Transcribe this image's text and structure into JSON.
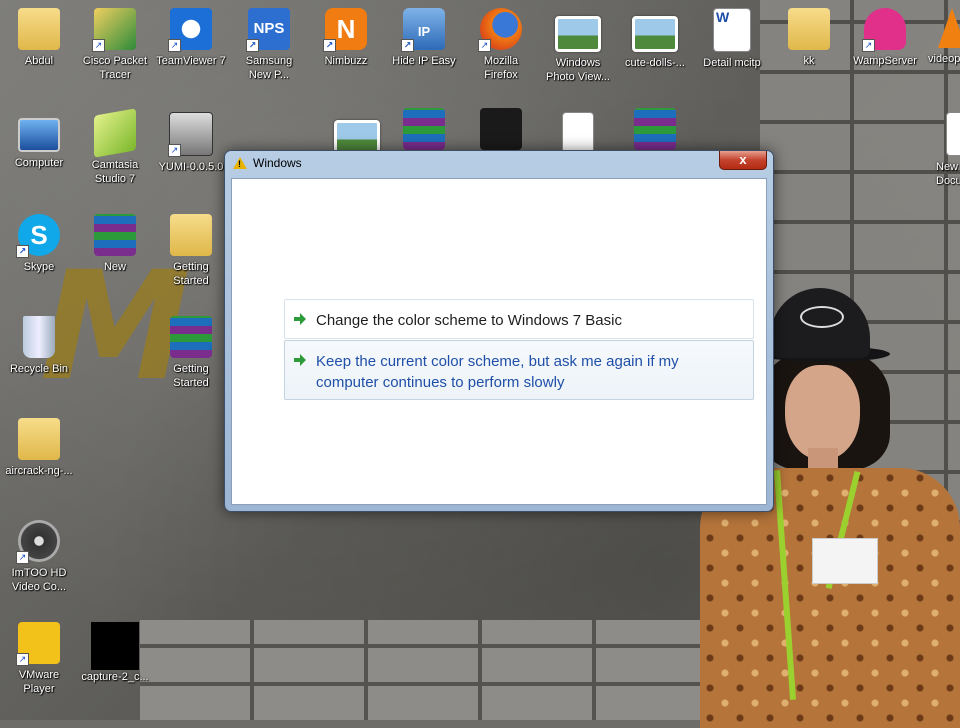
{
  "desktop": {
    "icons": [
      {
        "label": "Abdul",
        "icon": "user-folder-icon"
      },
      {
        "label": "Cisco Packet\nTracer",
        "icon": "cisco-packet-tracer-icon"
      },
      {
        "label": "TeamViewer 7",
        "icon": "teamviewer-icon"
      },
      {
        "label": "Samsung\nNew P...",
        "icon": "samsung-nps-icon",
        "badge": "NPS"
      },
      {
        "label": "Nimbuzz",
        "icon": "nimbuzz-icon",
        "badge": "N"
      },
      {
        "label": "Hide IP Easy",
        "icon": "lock-icon",
        "badge": "IP"
      },
      {
        "label": "Mozilla\nFirefox",
        "icon": "firefox-icon"
      },
      {
        "label": "Windows\nPhoto View...",
        "icon": "photo-viewer-icon"
      },
      {
        "label": "cute-dolls-...",
        "icon": "image-file-icon"
      },
      {
        "label": "Detail mcitp",
        "icon": "word-document-icon",
        "badge": "W"
      },
      {
        "label": "kk",
        "icon": "folder-icon"
      },
      {
        "label": "WampServer",
        "icon": "wampserver-icon"
      },
      {
        "label": "videop",
        "icon": "vlc-icon"
      },
      {
        "label": "Computer",
        "icon": "computer-icon"
      },
      {
        "label": "Camtasia\nStudio 7",
        "icon": "camtasia-icon"
      },
      {
        "label": "YUMI-0.0.5.0",
        "icon": "yumi-icon"
      },
      {
        "label": "New\nDocu",
        "icon": "text-document-icon"
      },
      {
        "label": "Skype",
        "icon": "skype-icon",
        "badge": "S"
      },
      {
        "label": "New",
        "icon": "winrar-archive-icon"
      },
      {
        "label": "Getting\nStarted",
        "icon": "folder-icon"
      },
      {
        "label": "Recycle Bin",
        "icon": "recycle-bin-icon"
      },
      {
        "label": "Getting\nStarted",
        "icon": "winrar-archive-icon"
      },
      {
        "label": "aircrack-ng-...",
        "icon": "folder-icon"
      },
      {
        "label": "ImTOO HD\nVideo Co...",
        "icon": "imtoo-video-converter-icon"
      },
      {
        "label": "VMware\nPlayer",
        "icon": "vmware-player-icon"
      },
      {
        "label": "capture-2_c...",
        "icon": "black-image-file-icon"
      }
    ]
  },
  "dialog": {
    "title": "Windows",
    "close_label": "x",
    "options": [
      {
        "label": "Change the color scheme to Windows 7 Basic"
      },
      {
        "label": "Keep the current color scheme, but ask me again if my computer continues to perform slowly"
      }
    ]
  },
  "colors": {
    "link_blue": "#1f4fa8",
    "arrow_green": "#2e9b3a",
    "close_red": "#c5432d"
  }
}
